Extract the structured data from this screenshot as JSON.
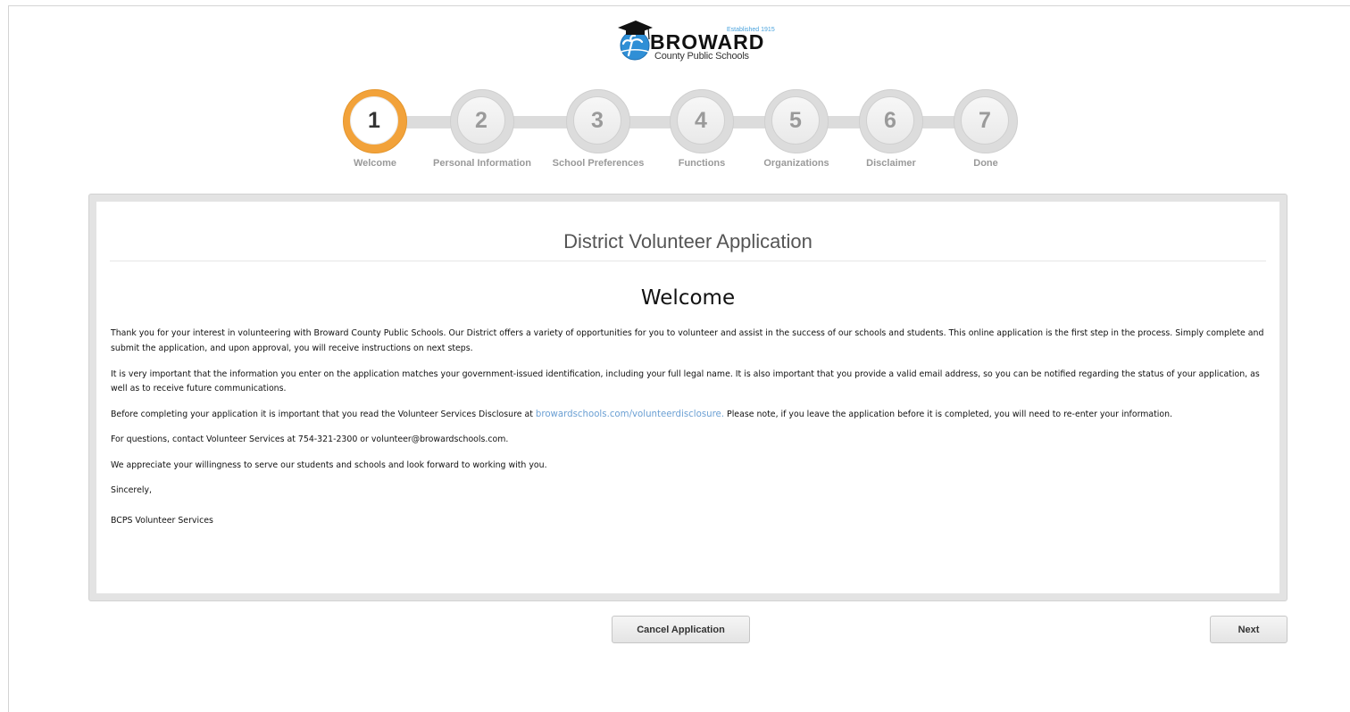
{
  "logo": {
    "established": "Established 1915",
    "brand": "BROWARD",
    "subtitle": "County Public Schools"
  },
  "steps": [
    {
      "number": "1",
      "label": "Welcome",
      "active": true
    },
    {
      "number": "2",
      "label": "Personal Information",
      "active": false
    },
    {
      "number": "3",
      "label": "School Preferences",
      "active": false
    },
    {
      "number": "4",
      "label": "Functions",
      "active": false
    },
    {
      "number": "5",
      "label": "Organizations",
      "active": false
    },
    {
      "number": "6",
      "label": "Disclaimer",
      "active": false
    },
    {
      "number": "7",
      "label": "Done",
      "active": false
    }
  ],
  "panel": {
    "title": "District Volunteer Application",
    "heading": "Welcome",
    "para1": "Thank you for your interest in volunteering with Broward County Public Schools. Our District offers a variety of opportunities for you to volunteer and assist in the success of our schools and students. This online application is the first step in the process. Simply complete and submit the application, and upon approval, you will receive instructions on next steps.",
    "para2": "It is very important that the information you enter on the application matches your government-issued identification, including your full legal name. It is also important that you provide a valid email address, so you can be notified regarding the status of your application, as well as to receive future communications.",
    "para3_before": "Before completing your application it is important that you read the Volunteer Services Disclosure at ",
    "para3_link": "browardschools.com/volunteerdisclosure.",
    "para3_after": " Please note, if you leave the application before it is completed, you will need to re-enter your information.",
    "para4": "For questions, contact Volunteer Services at 754-321-2300 or volunteer@browardschools.com.",
    "para5": "We appreciate your willingness to serve our students and schools and look forward to working with you.",
    "closing": "Sincerely,",
    "signature": "BCPS Volunteer Services"
  },
  "buttons": {
    "cancel": "Cancel Application",
    "next": "Next"
  },
  "colors": {
    "active_step": "#f2a23a",
    "link": "#6a9fd3",
    "logo_blue": "#2f8fd6"
  }
}
